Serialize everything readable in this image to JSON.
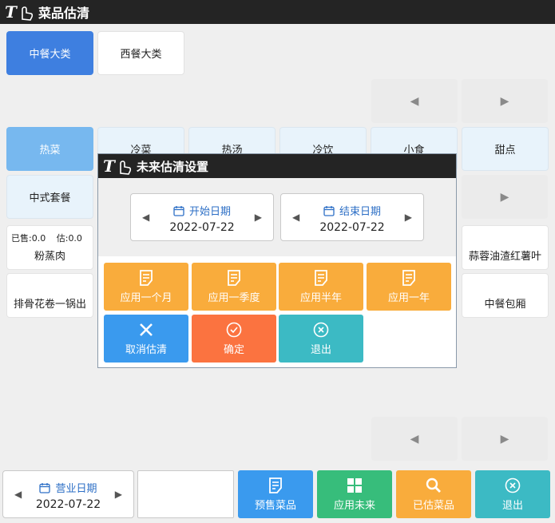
{
  "app": {
    "title": "菜品估清"
  },
  "categories": [
    "中餐大类",
    "西餐大类"
  ],
  "subcategories": [
    "热菜",
    "冷菜",
    "热汤",
    "冷饮",
    "小食",
    "甜点"
  ],
  "dishes": [
    {
      "name": "中式套餐"
    },
    {
      "name": "粉蒸肉",
      "sold_label": "已售:",
      "sold": "0.0",
      "est_label": "估:",
      "est": "0.0"
    },
    {
      "name": "排骨花卷一锅出"
    },
    {
      "name": "蒜蓉油渣红薯叶"
    },
    {
      "name": "中餐包厢"
    }
  ],
  "modal": {
    "title": "未来估清设置",
    "start_label": "开始日期",
    "start_date": "2022-07-22",
    "end_label": "结束日期",
    "end_date": "2022-07-22",
    "apply_month": "应用一个月",
    "apply_quarter": "应用一季度",
    "apply_half_year": "应用半年",
    "apply_year": "应用一年",
    "cancel": "取消估清",
    "confirm": "确定",
    "exit": "退出"
  },
  "footer": {
    "business_date_label": "营业日期",
    "business_date": "2022-07-22",
    "presale": "预售菜品",
    "apply_future": "应用未来",
    "estimated": "已估菜品",
    "exit": "退出"
  },
  "colors": {
    "titlebar": "#242424",
    "category_active": "#3e7fe0",
    "subcategory_active": "#77b8ef",
    "orange": "#f9ac3c",
    "blue": "#3a9aee",
    "red": "#fb7340",
    "teal": "#3cbac4",
    "green": "#37bd7b"
  },
  "icons": [
    "app-logo-icon",
    "prev-arrow-icon",
    "next-arrow-icon",
    "calendar-icon",
    "document-icon",
    "close-icon",
    "check-circle-icon",
    "exit-icon",
    "grid-icon",
    "search-icon"
  ]
}
